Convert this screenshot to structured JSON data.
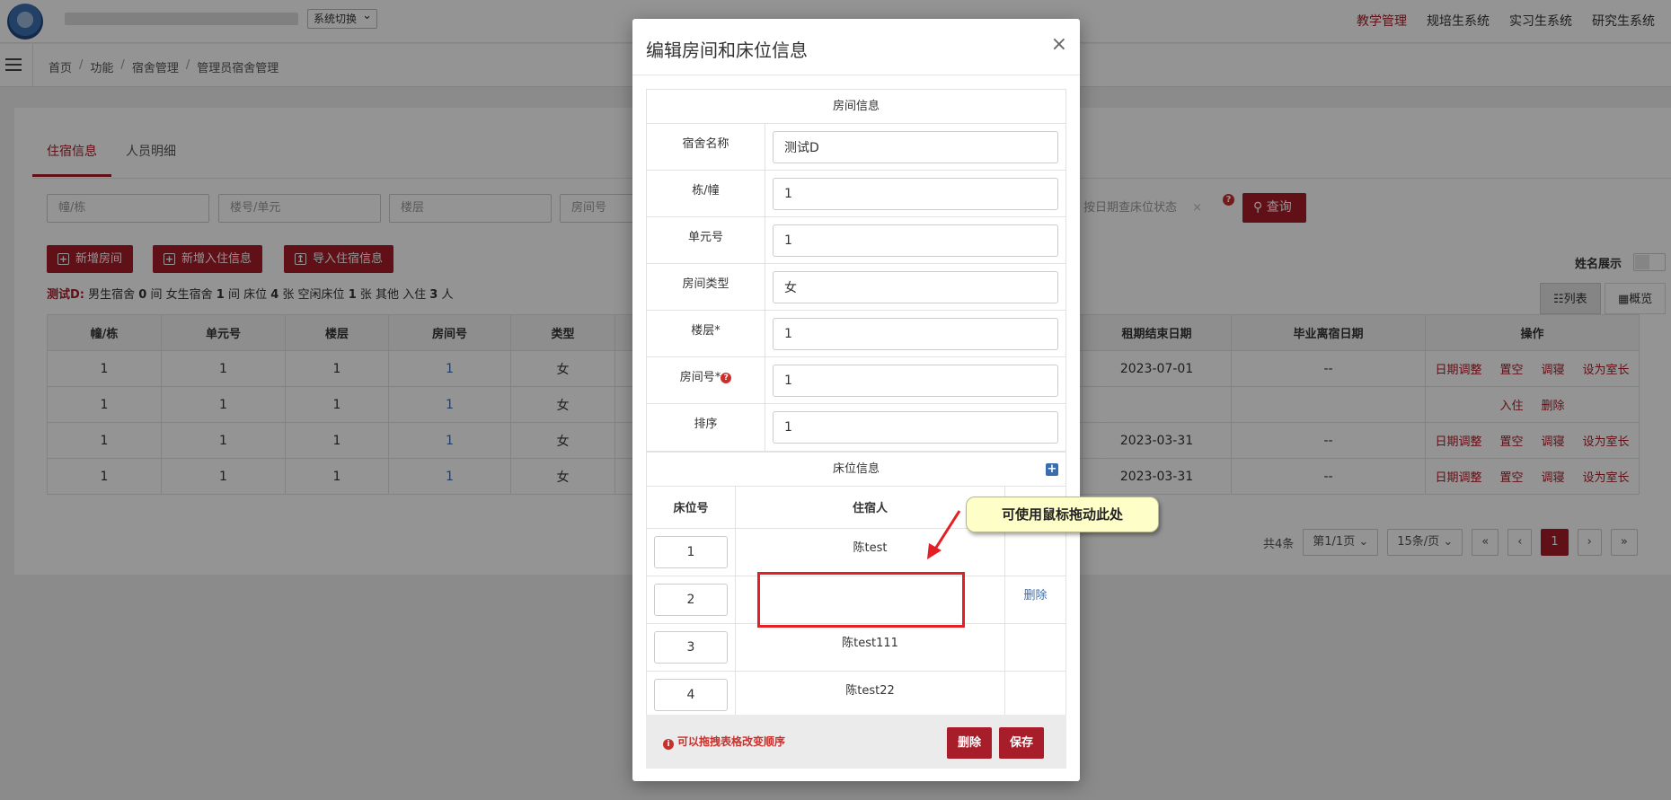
{
  "header": {
    "system_switch": "系统切换",
    "nav": [
      "教学管理",
      "规培生系统",
      "实习生系统",
      "研究生系统"
    ]
  },
  "breadcrumb": [
    "首页",
    "功能",
    "宿舍管理",
    "管理员宿舍管理"
  ],
  "tabs": [
    "住宿信息",
    "人员明细"
  ],
  "filters": {
    "building": "幢/栋",
    "unit": "楼号/单元",
    "floor": "楼层",
    "room": "房间号",
    "date": "按日期查床位状态",
    "search_button": "查询"
  },
  "actions": {
    "add_room": "新增房间",
    "add_checkin": "新增入住信息",
    "import_checkin": "导入住宿信息"
  },
  "summary": {
    "dorm": "测试D:",
    "text_a": "男生宿舍",
    "male": "0",
    "text_b": "间 女生宿舍",
    "female": "1",
    "text_c": "间 床位",
    "beds": "4",
    "text_d": "张 空闲床位",
    "free": "1",
    "text_e": "张 其他 入住",
    "occupied": "3",
    "text_f": "人"
  },
  "name_display": "姓名展示",
  "view": {
    "list": "列表",
    "overview": "概览"
  },
  "table": {
    "columns": [
      "幢/栋",
      "单元号",
      "楼层",
      "房间号",
      "类型",
      "租期结束日期",
      "毕业离宿日期",
      "操作"
    ],
    "rows": [
      {
        "building": "1",
        "unit": "1",
        "floor": "1",
        "room": "1",
        "type": "女",
        "lease_end": "2023-07-01",
        "grad_leave": "--",
        "ops": [
          "日期调整",
          "置空",
          "调寝",
          "设为室长"
        ]
      },
      {
        "building": "1",
        "unit": "1",
        "floor": "1",
        "room": "1",
        "type": "女",
        "lease_end": "",
        "grad_leave": "",
        "ops": [
          "入住",
          "删除"
        ]
      },
      {
        "building": "1",
        "unit": "1",
        "floor": "1",
        "room": "1",
        "type": "女",
        "lease_end": "2023-03-31",
        "grad_leave": "--",
        "ops": [
          "日期调整",
          "置空",
          "调寝",
          "设为室长"
        ]
      },
      {
        "building": "1",
        "unit": "1",
        "floor": "1",
        "room": "1",
        "type": "女",
        "lease_end": "2023-03-31",
        "grad_leave": "--",
        "ops": [
          "日期调整",
          "置空",
          "调寝",
          "设为室长"
        ]
      }
    ]
  },
  "pager": {
    "total": "共4条",
    "page": "第1/1页",
    "size": "15条/页",
    "first": "«",
    "prev": "‹",
    "current": "1",
    "next": "›",
    "last": "»"
  },
  "modal": {
    "title": "编辑房间和床位信息",
    "close": "×",
    "room_section": "房间信息",
    "fields": [
      {
        "label": "宿舍名称",
        "value": "测试D"
      },
      {
        "label": "栋/幢",
        "value": "1"
      },
      {
        "label": "单元号",
        "value": "1"
      },
      {
        "label": "房间类型",
        "value": "女"
      },
      {
        "label": "楼层*",
        "value": "1"
      },
      {
        "label": "房间号*",
        "value": "1"
      },
      {
        "label": "排序",
        "value": "1"
      }
    ],
    "bed_section": "床位信息",
    "bed_columns": [
      "床位号",
      "住宿人",
      ""
    ],
    "beds": [
      {
        "num": "1",
        "occupant": "陈test",
        "action": ""
      },
      {
        "num": "2",
        "occupant": "",
        "action": "删除"
      },
      {
        "num": "3",
        "occupant": "陈test111",
        "action": ""
      },
      {
        "num": "4",
        "occupant": "陈test22",
        "action": ""
      }
    ],
    "tip": "可以拖拽表格改变顺序",
    "delete_button": "删除",
    "save_button": "保存"
  },
  "annotation": "可使用鼠标拖动此处"
}
